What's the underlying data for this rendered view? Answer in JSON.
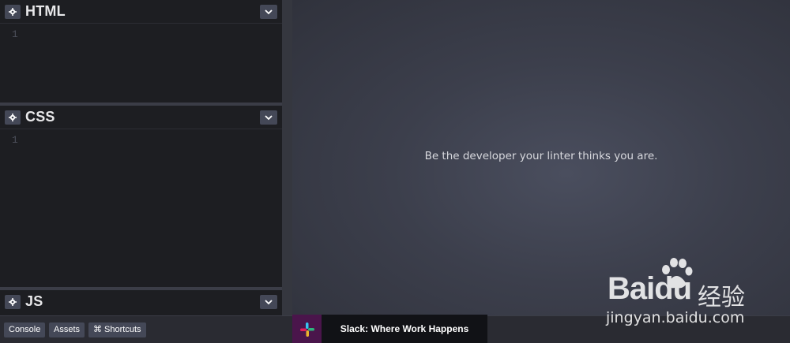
{
  "editors": [
    {
      "title": "HTML",
      "line_number": "1",
      "icon": "gear-icon",
      "toggle_icon": "chevron-down-icon"
    },
    {
      "title": "CSS",
      "line_number": "1",
      "icon": "gear-icon",
      "toggle_icon": "chevron-down-icon"
    },
    {
      "title": "JS",
      "icon": "gear-icon",
      "toggle_icon": "chevron-down-icon"
    }
  ],
  "preview": {
    "text": "Be the developer your linter thinks you are."
  },
  "footer": {
    "console_label": "Console",
    "assets_label": "Assets",
    "shortcuts_label": "⌘ Shortcuts",
    "ad_text": "Slack: Where Work Happens"
  },
  "watermark": {
    "brand": "Baidu",
    "chinese": "经验",
    "url": "jingyan.baidu.com"
  },
  "colors": {
    "editor_bg": "#1d1e22",
    "button_bg": "#444857",
    "preview_bg": "#3c3f4c",
    "slack_purple": "#4a154b"
  }
}
